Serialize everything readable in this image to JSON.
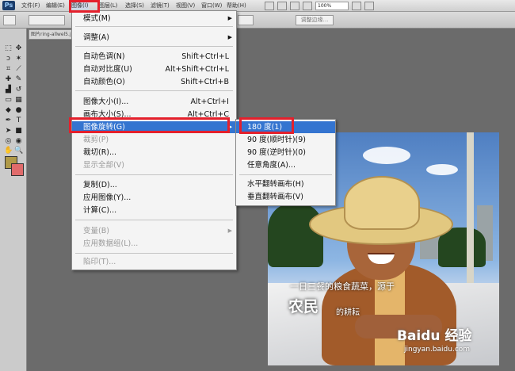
{
  "menubar": {
    "logo": "Ps",
    "items": [
      "文件(F)",
      "编辑(E)",
      "图像(I)",
      "图层(L)",
      "选择(S)",
      "滤镜(T)",
      "视图(V)",
      "窗口(W)",
      "帮助(H)"
    ],
    "zoom": "100%"
  },
  "optionsbar": {
    "refine_edge": "调整边缘..."
  },
  "document": {
    "tab": "图片ring-allwel5.jpg @ 100%"
  },
  "image_menu": {
    "mode": "模式(M)",
    "adjustments": "调整(A)",
    "auto_tone": "自动色调(N)",
    "auto_tone_sc": "Shift+Ctrl+L",
    "auto_contrast": "自动对比度(U)",
    "auto_contrast_sc": "Alt+Shift+Ctrl+L",
    "auto_color": "自动颜色(O)",
    "auto_color_sc": "Shift+Ctrl+B",
    "image_size": "图像大小(I)...",
    "image_size_sc": "Alt+Ctrl+I",
    "canvas_size": "画布大小(S)...",
    "canvas_size_sc": "Alt+Ctrl+C",
    "image_rotation": "图像旋转(G)",
    "crop": "裁剪(P)",
    "trim": "裁切(R)...",
    "reveal_all": "显示全部(V)",
    "duplicate": "复制(D)...",
    "apply_image": "应用图像(Y)...",
    "calculations": "计算(C)...",
    "variables": "变量(B)",
    "apply_dataset": "应用数据组(L)...",
    "trap": "陷印(T)..."
  },
  "rotate_menu": {
    "r180": "180 度(1)",
    "r90cw": "90 度(顺时针)(9)",
    "r90ccw": "90 度(逆时针)(0)",
    "arbitrary": "任意角度(A)...",
    "flip_h": "水平翻转画布(H)",
    "flip_v": "垂直翻转画布(V)"
  },
  "canvas_text": {
    "line1": "一日三餐的粮食蔬菜，源于",
    "big": "农民",
    "small": "的耕耘"
  },
  "watermark": {
    "brand": "Baidu 经验",
    "url": "jingyan.baidu.com"
  },
  "colors": {
    "highlight": "#3474d0",
    "annotation": "#e4202c",
    "foreground": "#b09a48",
    "background": "#e06b6b"
  }
}
